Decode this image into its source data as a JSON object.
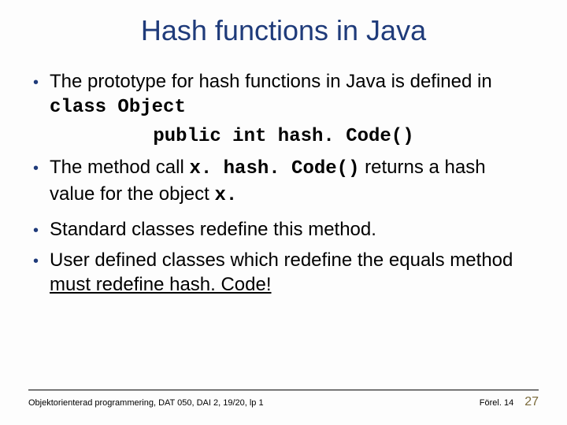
{
  "title": "Hash functions in Java",
  "bullets": {
    "b1_pre": "The prototype for hash functions in Java is defined in ",
    "b1_code": "class Object",
    "codeLine": "public int hash. Code()",
    "b2_pre": "The method call ",
    "b2_code1": "x. hash. Code()",
    "b2_mid": " returns a hash value for the object ",
    "b2_code2": "x.",
    "b3": "Standard classes redefine this method.",
    "b4_pre": "User defined classes which redefine the equals method ",
    "b4_underline": "must redefine hash. Code!"
  },
  "footer": {
    "left": "Objektorienterad programmering, DAT 050, DAI 2, 19/20, lp 1",
    "lecture": "Förel. 14",
    "page": "27"
  }
}
